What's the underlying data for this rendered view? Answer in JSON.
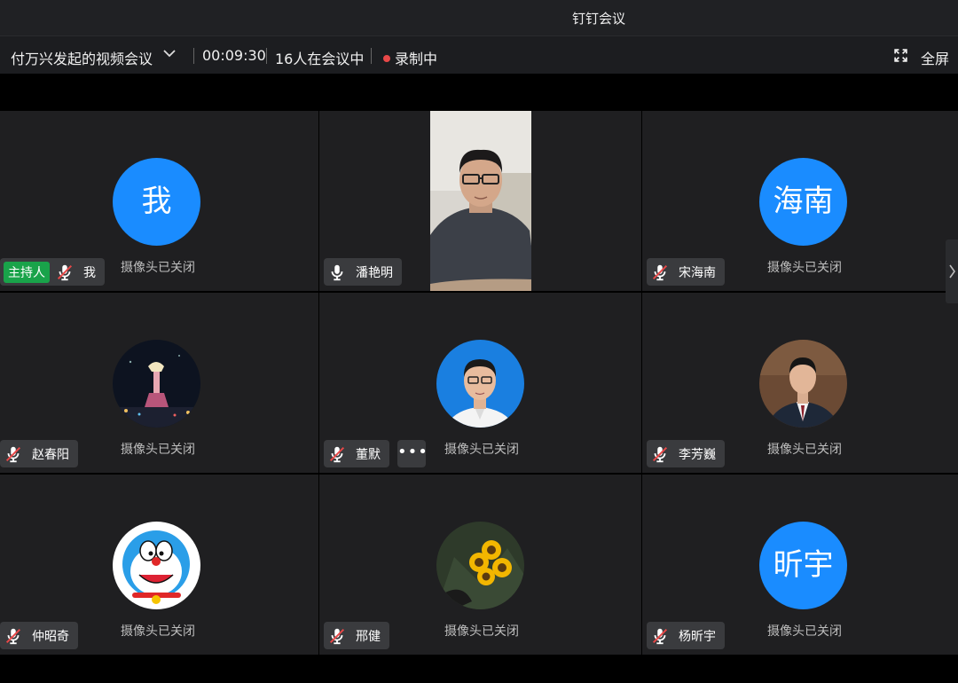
{
  "window": {
    "title": "钉钉会议"
  },
  "toolbar": {
    "meeting_title": "付万兴发起的视频会议",
    "duration": "00:09:30",
    "participants": "16人在会议中",
    "recording": "录制中",
    "fullscreen": "全屏"
  },
  "colors": {
    "accent": "#1a8cff",
    "host_badge": "#19a34a",
    "recording_dot": "#e84848"
  },
  "tiles": [
    {
      "name": "我",
      "avatar_text": "我",
      "host_label": "主持人",
      "status": "摄像头已关闭",
      "mic": "muted"
    },
    {
      "name": "潘艳明",
      "status": "",
      "mic": "on",
      "video": "live-camera"
    },
    {
      "name": "宋海南",
      "avatar_text": "海南",
      "status": "摄像头已关闭",
      "mic": "muted"
    },
    {
      "name": "赵春阳",
      "status": "摄像头已关闭",
      "mic": "muted",
      "avatar": "photo-night-tower"
    },
    {
      "name": "董默",
      "status": "摄像头已关闭",
      "mic": "muted",
      "avatar": "photo-man-glasses",
      "more": "•••"
    },
    {
      "name": "李芳巍",
      "status": "摄像头已关闭",
      "mic": "muted",
      "avatar": "photo-man-suit"
    },
    {
      "name": "仲昭奇",
      "status": "摄像头已关闭",
      "mic": "muted",
      "avatar": "photo-doraemon"
    },
    {
      "name": "邢健",
      "status": "摄像头已关闭",
      "mic": "muted",
      "avatar": "photo-sunflowers"
    },
    {
      "name": "杨昕宇",
      "avatar_text": "昕宇",
      "status": "摄像头已关闭",
      "mic": "muted"
    }
  ]
}
